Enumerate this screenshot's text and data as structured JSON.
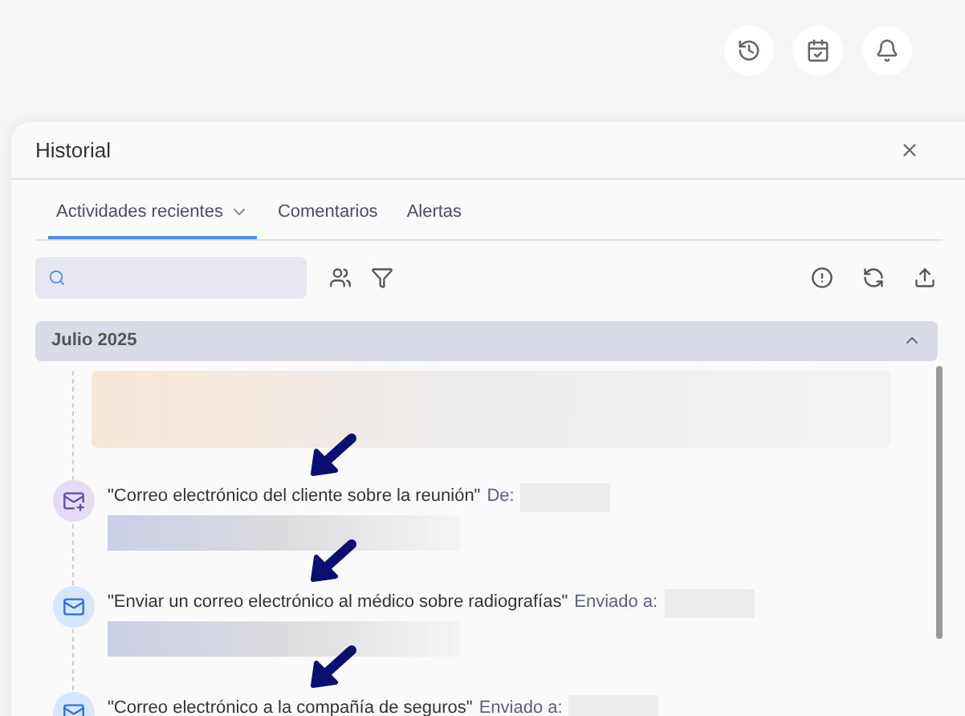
{
  "panel": {
    "title": "Historial"
  },
  "tabs": [
    {
      "label": "Actividades recientes",
      "selected": true,
      "dropdown": true
    },
    {
      "label": "Comentarios",
      "selected": false,
      "dropdown": false
    },
    {
      "label": "Alertas",
      "selected": false,
      "dropdown": false
    }
  ],
  "month": {
    "label": "Julio 2025",
    "expanded": true
  },
  "activities": [
    {
      "kind": "redacted"
    },
    {
      "kind": "received",
      "title": "\"Correo electrónico del cliente sobre la reunión\"",
      "party_label": "De:"
    },
    {
      "kind": "sent",
      "title": "\"Enviar un correo electrónico al médico sobre radiografías\"",
      "party_label": "Enviado a:"
    },
    {
      "kind": "sent",
      "title": "\"Correo electrónico a la compañía de seguros\"",
      "party_label": "Enviado a:"
    }
  ]
}
